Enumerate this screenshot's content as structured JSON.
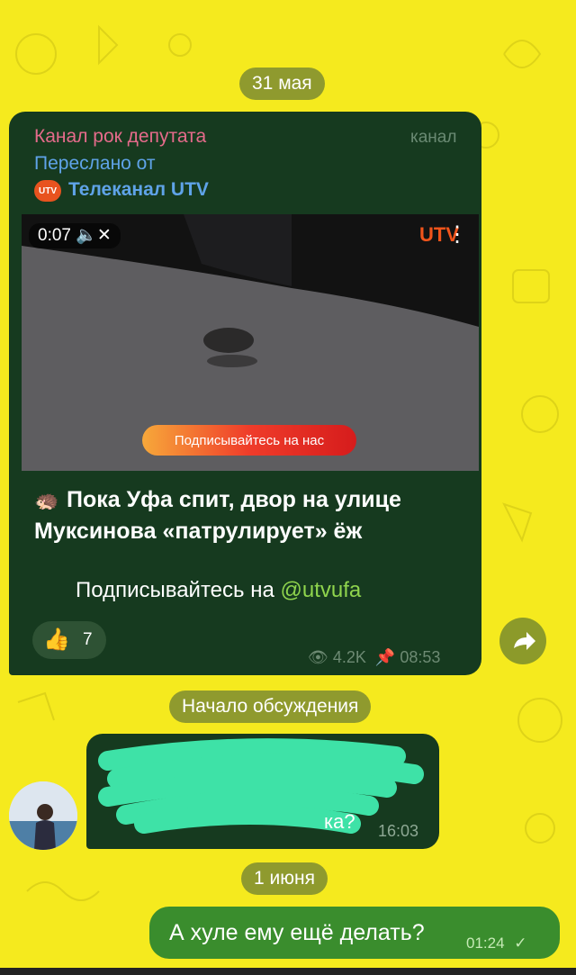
{
  "chat": {
    "date1": "31 мая",
    "date2": "1 июня",
    "discussion_label": "Начало обсуждения"
  },
  "post": {
    "channel_name": "Канал рок депутата",
    "channel_tag": "канал",
    "forwarded_label": "Переслано от",
    "forwarded_source": "Телеканал UTV",
    "source_avatar_text": "UTV",
    "video": {
      "time": "0:07",
      "logo": "UTV",
      "subscribe_banner": "Подписывайтесь на нас"
    },
    "text_line1": "Пока Уфа спит, двор на улице",
    "text_line2": "Муксинова «патрулирует» ёж",
    "subscribe_prefix": "Подписывайтесь на ",
    "subscribe_link": "@utvufa",
    "reaction_count": "7",
    "views": "4.2K",
    "time": "08:53"
  },
  "incoming": {
    "time": "16:03",
    "partial_text": "ка?"
  },
  "outgoing": {
    "text": "А хуле ему ещё делать?",
    "time": "01:24"
  },
  "colors": {
    "background": "#f5ea1e",
    "bubble_dark": "#163a1f",
    "outgoing_bubble": "#3a8d2d",
    "pill": "#8f9a2e",
    "link": "#8fd44d"
  }
}
